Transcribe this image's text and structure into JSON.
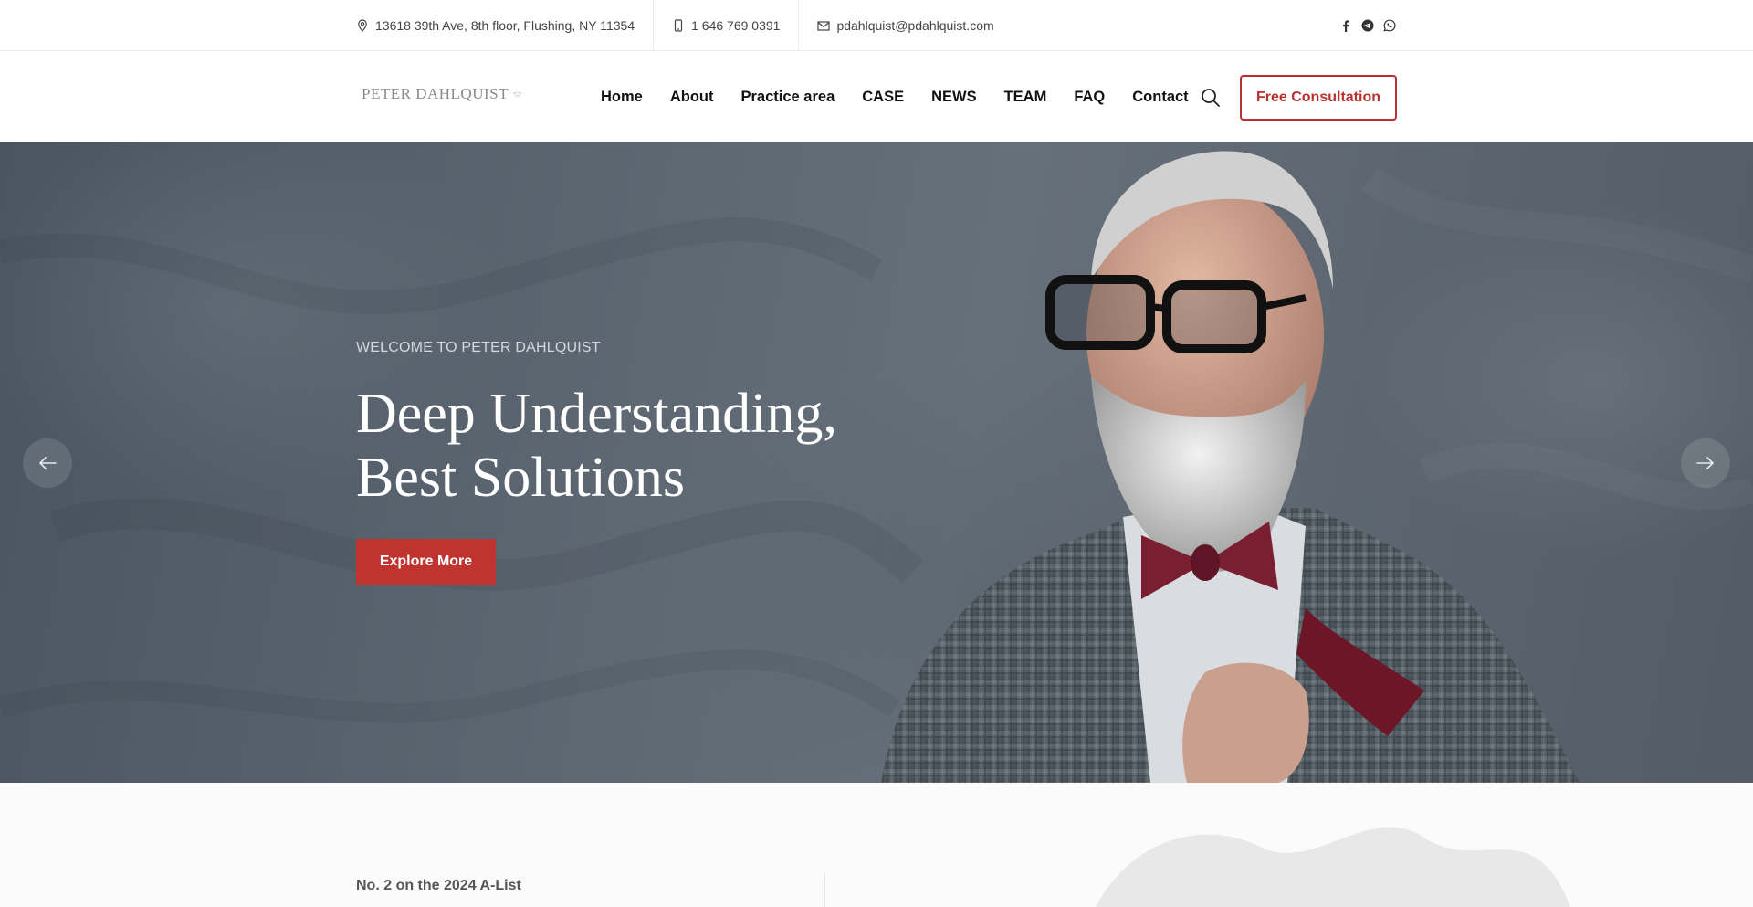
{
  "topbar": {
    "address": "13618 39th Ave, 8th floor, Flushing, NY 11354",
    "phone": "1 646 769 0391",
    "email": "pdahlquist@pdahlquist.com",
    "social_icons": [
      "facebook-icon",
      "telegram-icon",
      "whatsapp-icon"
    ]
  },
  "header": {
    "logo_text": "PETER DAHLQUIST",
    "nav": [
      "Home",
      "About",
      "Practice area",
      "CASE",
      "NEWS",
      "TEAM",
      "FAQ",
      "Contact"
    ],
    "cta_label": "Free Consultation"
  },
  "hero": {
    "eyebrow": "WELCOME TO PETER DAHLQUIST",
    "title_line1": "Deep Understanding,",
    "title_line2": "Best Solutions",
    "button_label": "Explore More"
  },
  "below": {
    "alist_text": "No. 2 on the 2024 A-List"
  },
  "colors": {
    "accent": "#c0342f",
    "accent_outline": "#b8312f",
    "hero_overlay": "#5d6772",
    "nav_text": "#111111"
  }
}
